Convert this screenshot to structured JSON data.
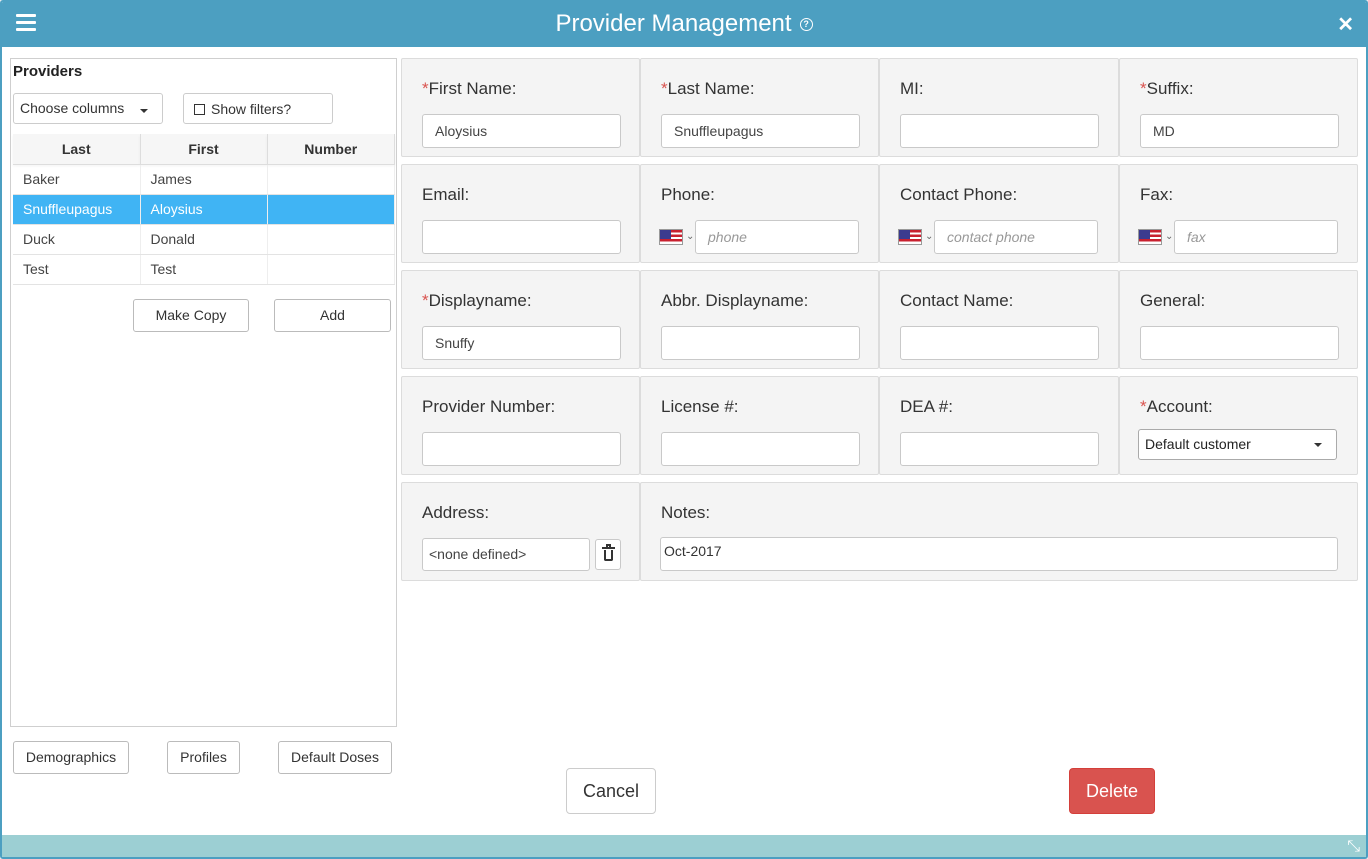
{
  "window": {
    "title": "Provider Management"
  },
  "providers": {
    "title": "Providers",
    "choose_columns": "Choose columns",
    "show_filters": "Show filters?",
    "columns": [
      "Last",
      "First",
      "Number"
    ],
    "rows": [
      {
        "last": "Baker",
        "first": "James",
        "number": ""
      },
      {
        "last": "Snuffleupagus",
        "first": "Aloysius",
        "number": "",
        "selected": true
      },
      {
        "last": "Duck",
        "first": "Donald",
        "number": ""
      },
      {
        "last": "Test",
        "first": "Test",
        "number": ""
      }
    ],
    "make_copy": "Make Copy",
    "add": "Add",
    "demographics": "Demographics",
    "profiles": "Profiles",
    "default_doses": "Default Doses"
  },
  "form": {
    "first_name": {
      "label": "First Name:",
      "value": "Aloysius"
    },
    "last_name": {
      "label": "Last Name:",
      "value": "Snuffleupagus"
    },
    "mi": {
      "label": "MI:",
      "value": ""
    },
    "suffix": {
      "label": "Suffix:",
      "value": "MD"
    },
    "email": {
      "label": "Email:",
      "value": ""
    },
    "phone": {
      "label": "Phone:",
      "placeholder": "phone"
    },
    "contact_phone": {
      "label": "Contact Phone:",
      "placeholder": "contact phone"
    },
    "fax": {
      "label": "Fax:",
      "placeholder": "fax"
    },
    "displayname": {
      "label": "Displayname:",
      "value": "Snuffy"
    },
    "abbr_displayname": {
      "label": "Abbr. Displayname:",
      "value": ""
    },
    "contact_name": {
      "label": "Contact Name:",
      "value": ""
    },
    "general": {
      "label": "General:",
      "value": ""
    },
    "provider_number": {
      "label": "Provider Number:",
      "value": ""
    },
    "license": {
      "label": "License #:",
      "value": ""
    },
    "dea": {
      "label": "DEA #:",
      "value": ""
    },
    "account": {
      "label": "Account:",
      "value": "Default customer"
    },
    "address": {
      "label": "Address:",
      "value": "<none defined>"
    },
    "notes": {
      "label": "Notes:",
      "value": "Oct-2017"
    }
  },
  "actions": {
    "cancel": "Cancel",
    "delete": "Delete"
  },
  "colors": {
    "titlebar": "#4c9fc1",
    "selected_row": "#40b4f4",
    "required": "#d9534f",
    "delete": "#d9534f"
  }
}
